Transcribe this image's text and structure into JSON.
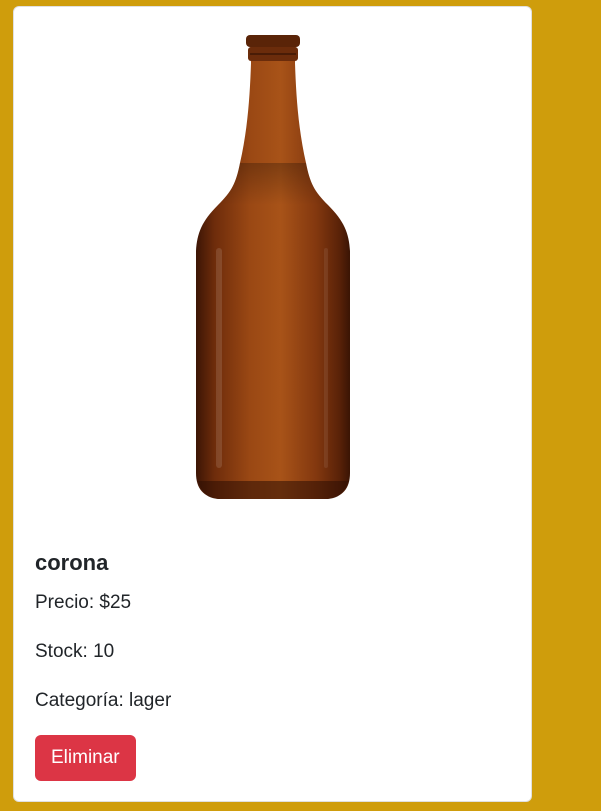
{
  "product": {
    "name": "corona",
    "price_label": "Precio:",
    "price_value": "$25",
    "stock_label": "Stock:",
    "stock_value": "10",
    "category_label": "Categoría:",
    "category_value": "lager",
    "image_icon": "beer-bottle-icon"
  },
  "actions": {
    "delete_label": "Eliminar"
  },
  "colors": {
    "background": "#cf9d0c",
    "card": "#ffffff",
    "danger": "#dc3545",
    "bottle": "#8b3c10",
    "text": "#212529"
  }
}
